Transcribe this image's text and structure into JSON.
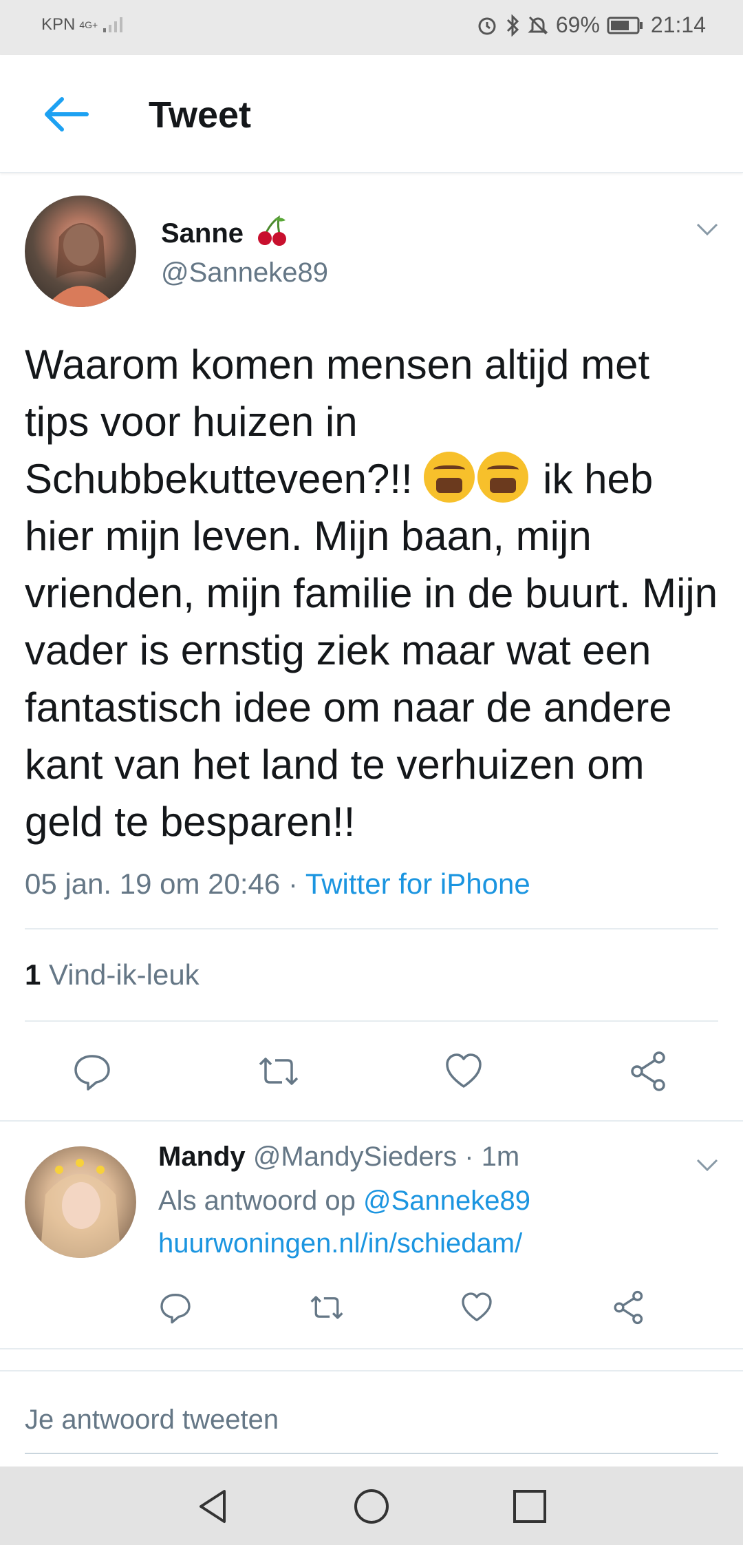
{
  "status_bar": {
    "carrier": "KPN",
    "network": "4G+",
    "battery": "69%",
    "time": "21:14",
    "icons": [
      "alarm-icon",
      "bluetooth-icon",
      "mute-icon",
      "battery-icon"
    ]
  },
  "header": {
    "title": "Tweet",
    "back_icon": "arrow-left-icon"
  },
  "tweet": {
    "name": "Sanne",
    "name_emoji": "cherry-icon",
    "handle": "@Sanneke89",
    "text_part1": "Waarom komen mensen altijd met tips voor huizen in Schubbekutteveen?!! ",
    "text_part2": " ik heb hier mijn leven. Mijn baan, mijn vrienden, mijn familie in de buurt. Mijn vader is ernstig ziek maar wat een fantastisch idee om naar de andere kant van het land te verhuizen om geld te besparen!!",
    "text_emoji": "weary-face-icon",
    "timestamp": "05 jan. 19 om 20:46",
    "separator": "·",
    "source": "Twitter for iPhone",
    "likes_count": "1",
    "likes_label": "Vind-ik-leuk"
  },
  "reply": {
    "name": "Mandy",
    "handle": "@MandySieders",
    "separator": "·",
    "age": "1m",
    "in_reply_prefix": "Als antwoord op",
    "in_reply_handle": "@Sanneke89",
    "link": "huurwoningen.nl/in/schiedam/"
  },
  "compose": {
    "placeholder": "Je antwoord tweeten"
  },
  "colors": {
    "accent": "#1b95e0",
    "text": "#14171a",
    "secondary": "#657786"
  }
}
